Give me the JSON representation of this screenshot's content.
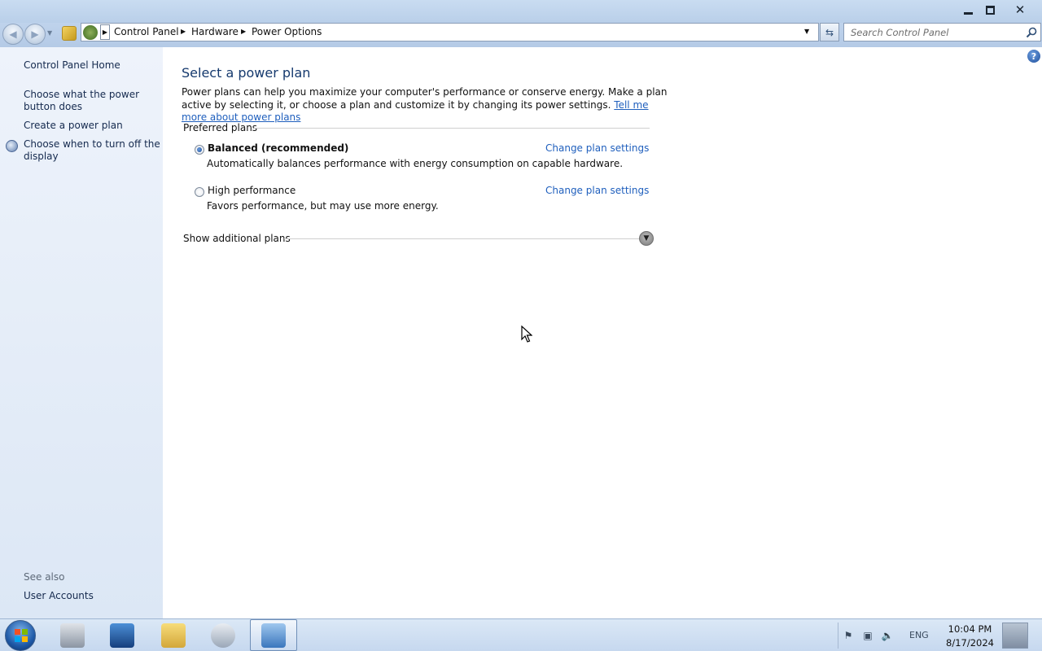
{
  "window": {
    "minimize_icon": "minimize-icon",
    "maximize_icon": "restore-icon",
    "close_icon": "close-icon"
  },
  "navbar": {
    "breadcrumbs": [
      "Control Panel",
      "Hardware",
      "Power Options"
    ],
    "search_placeholder": "Search Control Panel"
  },
  "sidebar": {
    "items": [
      {
        "label": "Control Panel Home"
      },
      {
        "label": "Choose what the power button does"
      },
      {
        "label": "Create a power plan"
      },
      {
        "label": "Choose when to turn off the display"
      }
    ],
    "see_also_label": "See also",
    "see_also_items": [
      {
        "label": "User Accounts"
      }
    ]
  },
  "main": {
    "title": "Select a power plan",
    "description": "Power plans can help you maximize your computer's performance or conserve energy. Make a plan active by selecting it, or choose a plan and customize it by changing its power settings.",
    "description_link": "Tell me more about power plans",
    "section_label": "Preferred plans",
    "plans": [
      {
        "name": "Balanced (recommended)",
        "description": "Automatically balances performance with energy consumption on capable hardware.",
        "selected": true,
        "change_label": "Change plan settings"
      },
      {
        "name": "High performance",
        "description": "Favors performance, but may use more energy.",
        "selected": false,
        "change_label": "Change plan settings"
      }
    ],
    "show_additional": "Show additional plans"
  },
  "taskbar": {
    "apps": [
      "server-manager-icon",
      "powershell-icon",
      "file-explorer-icon",
      "disk-utility-icon",
      "control-panel-icon"
    ],
    "language": "ENG",
    "time": "10:04 PM",
    "date": "8/17/2024"
  }
}
